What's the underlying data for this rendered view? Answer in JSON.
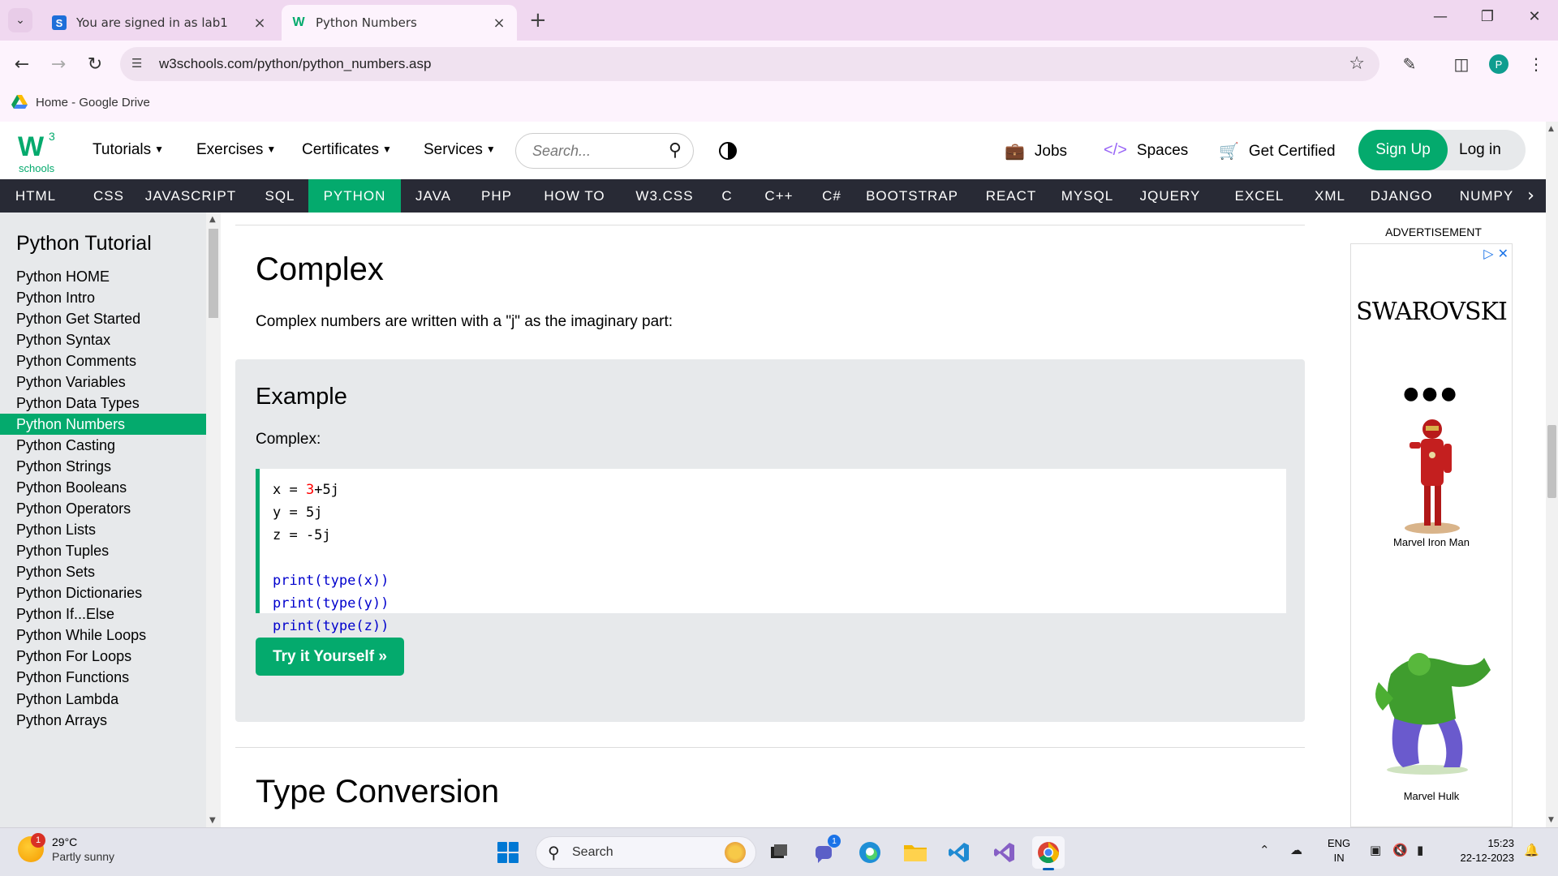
{
  "browser": {
    "tabs": [
      {
        "title": "You are signed in as lab1",
        "favicon": "S"
      },
      {
        "title": "Python Numbers",
        "favicon": "W"
      }
    ],
    "url": "w3schools.com/python/python_numbers.asp",
    "profile_initial": "P",
    "bookmark": "Home - Google Drive"
  },
  "w3": {
    "logo_superscript": "3",
    "logo_text": "schools",
    "menu": [
      "Tutorials",
      "Exercises",
      "Certificates",
      "Services"
    ],
    "search_placeholder": "Search...",
    "links": {
      "jobs": "Jobs",
      "spaces": "Spaces",
      "certified": "Get Certified"
    },
    "signup": "Sign Up",
    "login": "Log in",
    "topnav": [
      "HTML",
      "CSS",
      "JAVASCRIPT",
      "SQL",
      "PYTHON",
      "JAVA",
      "PHP",
      "HOW TO",
      "W3.CSS",
      "C",
      "C++",
      "C#",
      "BOOTSTRAP",
      "REACT",
      "MYSQL",
      "JQUERY",
      "EXCEL",
      "XML",
      "DJANGO",
      "NUMPY"
    ],
    "topnav_active": "PYTHON",
    "accent_color": "#04aa6d",
    "dark_nav_color": "#282a35"
  },
  "sidebar": {
    "title": "Python Tutorial",
    "items": [
      "Python HOME",
      "Python Intro",
      "Python Get Started",
      "Python Syntax",
      "Python Comments",
      "Python Variables",
      "Python Data Types",
      "Python Numbers",
      "Python Casting",
      "Python Strings",
      "Python Booleans",
      "Python Operators",
      "Python Lists",
      "Python Tuples",
      "Python Sets",
      "Python Dictionaries",
      "Python If...Else",
      "Python While Loops",
      "Python For Loops",
      "Python Functions",
      "Python Lambda",
      "Python Arrays"
    ],
    "active": "Python Numbers"
  },
  "content": {
    "heading": "Complex",
    "intro": "Complex numbers are written with a \"j\" as the imaginary part:",
    "example_title": "Example",
    "example_sub": "Complex:",
    "code": {
      "line1": {
        "a": "x = ",
        "num": "3",
        "b": "+5j"
      },
      "line2": "y = 5j",
      "line3": "z = -5j",
      "print_lines": [
        {
          "fn1": "print",
          "p1": "(",
          "fn2": "type",
          "arg": "(x))"
        },
        {
          "fn1": "print",
          "p1": "(",
          "fn2": "type",
          "arg": "(y))"
        },
        {
          "fn1": "print",
          "p1": "(",
          "fn2": "type",
          "arg": "(z))"
        }
      ]
    },
    "try_button": "Try it Yourself »",
    "next_heading": "Type Conversion"
  },
  "ad": {
    "label": "ADVERTISEMENT",
    "brand": "SWAROVSKI",
    "product1": "Marvel Iron Man",
    "product2": "Marvel Hulk"
  },
  "taskbar": {
    "weather_temp": "29°C",
    "weather_cond": "Partly sunny",
    "weather_badge": "1",
    "search": "Search",
    "teams_badge": "1",
    "lang1": "ENG",
    "lang2": "IN",
    "time": "15:23",
    "date": "22-12-2023"
  }
}
